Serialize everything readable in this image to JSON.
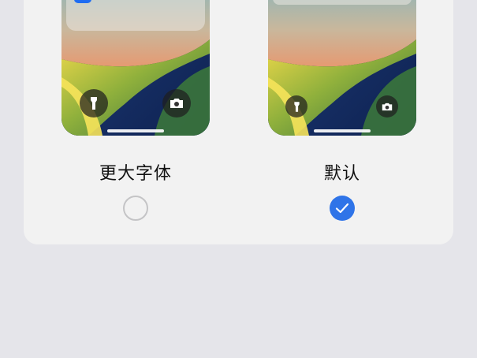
{
  "options": [
    {
      "label": "更大字体",
      "selected": false
    },
    {
      "label": "默认",
      "selected": true
    }
  ],
  "colors": {
    "accent": "#2f74e8",
    "card_bg": "#f2f2f2",
    "page_bg": "#e5e5ea"
  },
  "icons": {
    "flashlight": "flashlight-icon",
    "camera": "camera-icon",
    "check": "checkmark-icon"
  }
}
